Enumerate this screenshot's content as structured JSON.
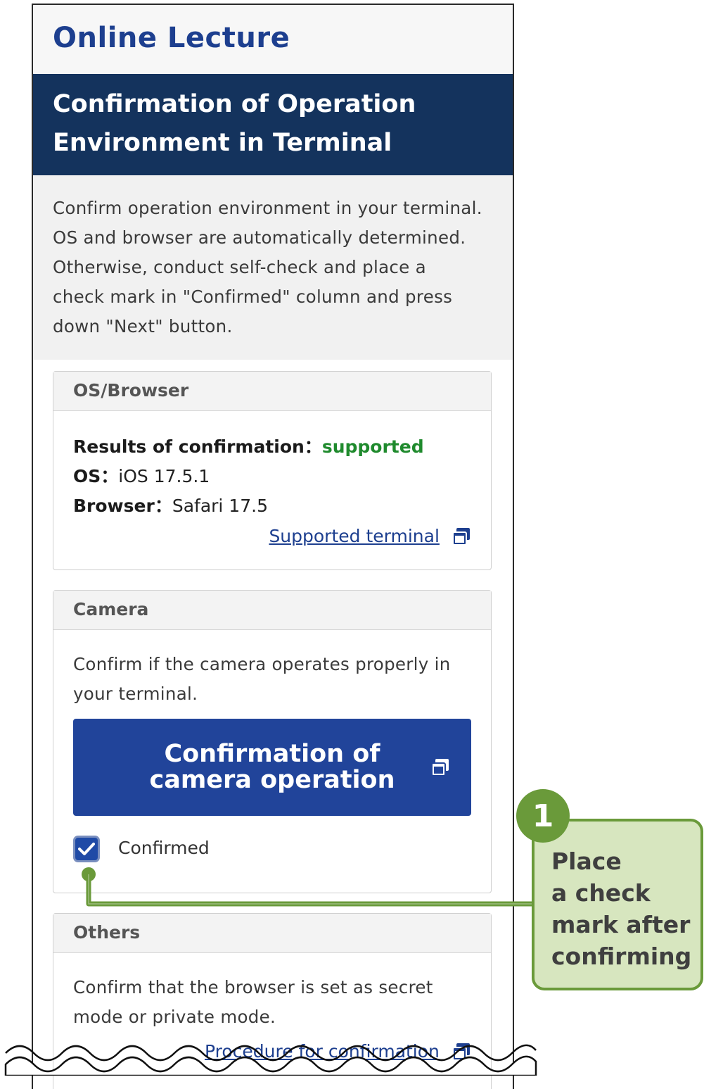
{
  "app": {
    "title": "Online Lecture"
  },
  "page": {
    "title_line1": "Confirmation of Operation",
    "title_line2": "Environment in Terminal"
  },
  "intro": {
    "lines": [
      "Confirm operation environment in your terminal.",
      "OS and browser are automatically determined.",
      "Otherwise, conduct self-check and place a",
      "check mark in \"Confirmed\" column and press",
      "down \"Next\" button."
    ]
  },
  "os_browser": {
    "header": "OS/Browser",
    "result_label": "Results of confirmation：",
    "result_value": "supported",
    "os_label": "OS：",
    "os_value": "iOS 17.5.1",
    "browser_label": "Browser：",
    "browser_value": "Safari 17.5",
    "link_label": "Supported terminal"
  },
  "camera": {
    "header": "Camera",
    "line1": "Confirm if the camera operates properly in",
    "line2": "your terminal.",
    "button_line1": "Confirmation of",
    "button_line2": "camera operation",
    "checkbox_label": "Confirmed",
    "checked": true
  },
  "others": {
    "header": "Others",
    "line1": "Confirm that the browser is set as secret",
    "line2": "mode or private mode.",
    "link_partial": "Procedure for confirmation"
  },
  "callout": {
    "number": "1",
    "lines": [
      "Place",
      "a check",
      "mark after",
      "confirming"
    ]
  },
  "colors": {
    "navy": "#14335d",
    "button_blue": "#21449a",
    "link": "#1d3f8f",
    "supported": "#1f8a2d",
    "callout_green": "#6a9a3a",
    "callout_fill": "#d7e6bf"
  },
  "icons": {
    "external": "external-window-icon",
    "check": "checkmark-icon"
  }
}
